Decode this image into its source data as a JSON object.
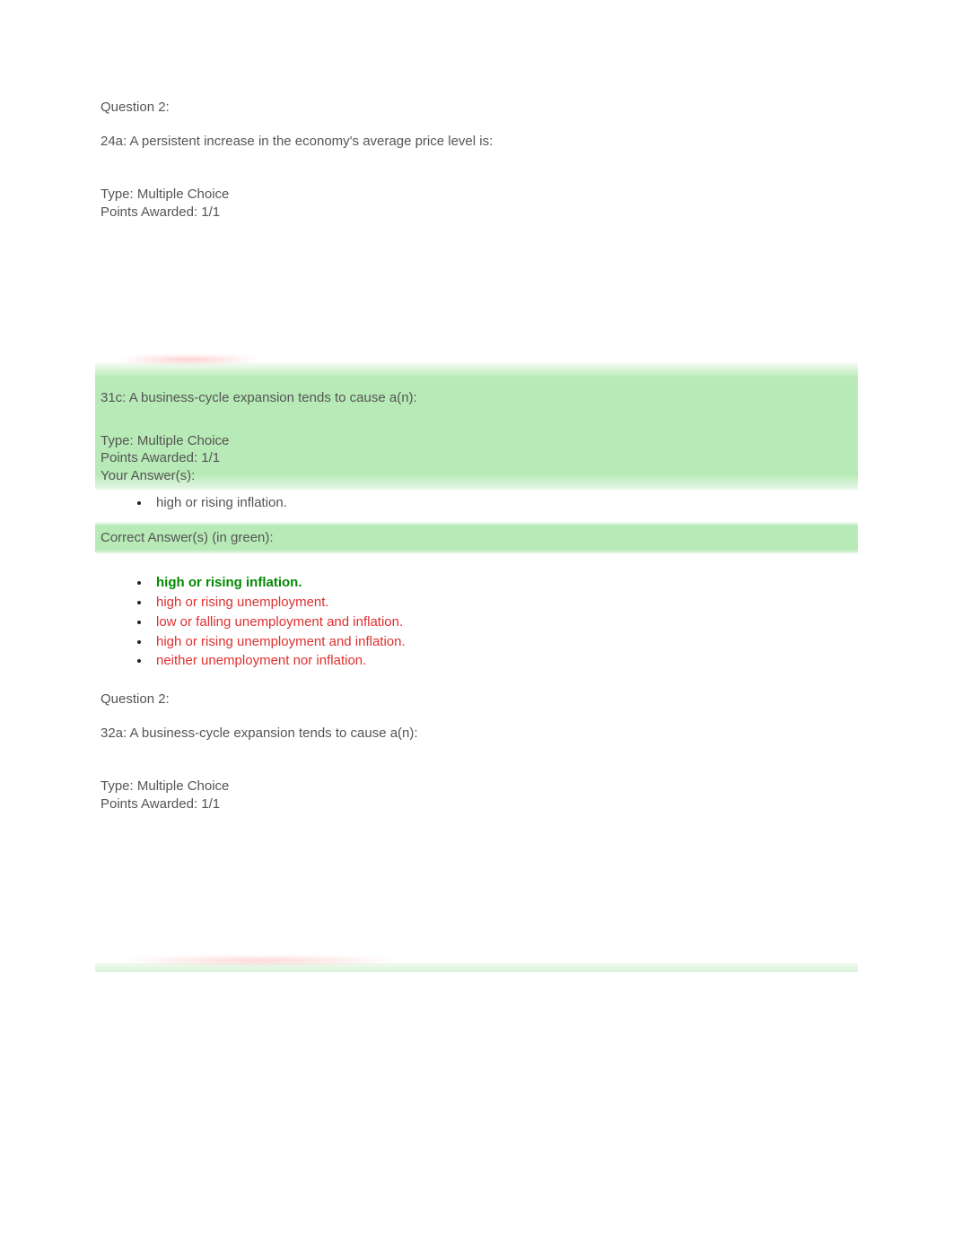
{
  "q2a": {
    "label": "Question 2:",
    "text": "24a: A persistent increase in the economy's average price level is:",
    "type_line": "Type: Multiple Choice",
    "points_line": "Points Awarded: 1/1"
  },
  "q31c": {
    "text": "31c: A business-cycle expansion tends to cause a(n):",
    "type_line": "Type: Multiple Choice",
    "points_line": "Points Awarded: 1/1",
    "your_answers_label": "Your Answer(s):",
    "your_answer": "high or rising inflation.",
    "correct_label": "Correct Answer(s) (in green):",
    "options": [
      {
        "text": "high or rising inflation.",
        "state": "correct"
      },
      {
        "text": "high or rising unemployment.",
        "state": "wrong"
      },
      {
        "text": "low or falling unemployment and inflation.",
        "state": "wrong"
      },
      {
        "text": "high or rising unemployment and inflation.",
        "state": "wrong"
      },
      {
        "text": "neither unemployment nor inflation.",
        "state": "wrong"
      }
    ]
  },
  "q2b": {
    "label": "Question 2:",
    "text": "32a: A business-cycle expansion tends to cause a(n):",
    "type_line": "Type: Multiple Choice",
    "points_line": "Points Awarded: 1/1"
  }
}
